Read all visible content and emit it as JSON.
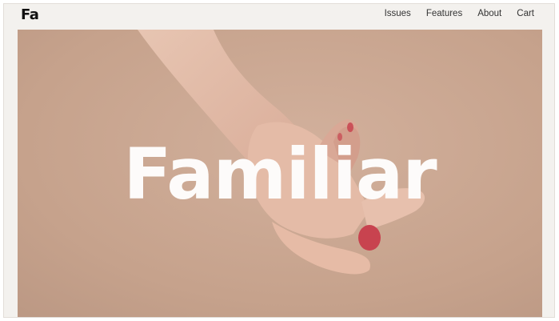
{
  "header": {
    "logo": "Fa",
    "nav": [
      "Issues",
      "Features",
      "About",
      "Cart"
    ]
  },
  "hero": {
    "title": "Familiar",
    "image_subject": "hand-photo"
  },
  "colors": {
    "frame_bg": "#f3f1ee",
    "hero_bg": "#c8a58f",
    "title": "#fdfbfa",
    "nav_text": "#333333",
    "nail": "#c8434f"
  }
}
